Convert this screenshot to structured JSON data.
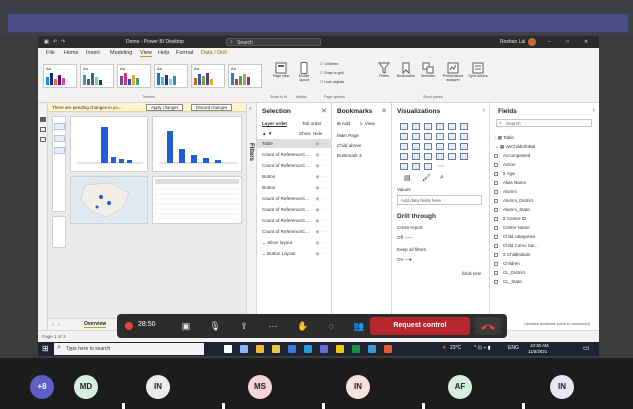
{
  "app": {
    "window_title": "Demo - Power BI Desktop",
    "search_placeholder": "Search",
    "user": "Roshan Lal",
    "user_initials": "RL",
    "contextual_tab": "Data / Drill"
  },
  "ribbon": {
    "tabs": [
      "File",
      "Home",
      "Insert",
      "Modeling",
      "View",
      "Help",
      "Format"
    ],
    "active_tab": "View",
    "groups": {
      "themes": "Themes",
      "scale": "Scale to fit",
      "mobile": "Mobile",
      "page_options": "Page options",
      "show_panes": "Show panes"
    },
    "buttons": {
      "page_view": "Page view",
      "mobile_layout": "Mobile layout",
      "gridlines": "Gridlines",
      "snap": "Snap to grid",
      "lock": "Lock objects",
      "filters": "Filters",
      "bookmarks": "Bookmarks",
      "selection": "Selection",
      "performance": "Performance analyzer",
      "sync": "Sync slicers"
    }
  },
  "warning": {
    "text": "There are pending changes in yo...",
    "apply": "Apply changes",
    "discard": "Discard changes"
  },
  "filters_label": "Filters",
  "selection_pane": {
    "title": "Selection",
    "tab_layer": "Layer order",
    "tab_order": "Tab order",
    "show": "Show",
    "hide": "Hide",
    "items": [
      "Table",
      "Count of ReferenceC...",
      "Count of ReferenceC...",
      "Button",
      "Button",
      "Count of ReferenceC...",
      "Count of ReferenceC...",
      "Count of ReferenceC...",
      "Count of ReferenceC...",
      "Slicer layout",
      "Button Layout"
    ]
  },
  "bookmarks_pane": {
    "title": "Bookmarks",
    "add": "Add",
    "view": "View",
    "items": [
      "Main Page",
      "Child above",
      "Bookmark 3"
    ]
  },
  "visualizations_pane": {
    "title": "Visualizations",
    "values_label": "Values",
    "add_fields": "Add data fields here",
    "drill_through": "Drill through",
    "cross_report": "Cross-report",
    "cross_report_state": "Off",
    "keep_filters": "Keep all filters",
    "keep_filters_state": "On",
    "drill_fields": "fields here"
  },
  "fields_pane": {
    "title": "Fields",
    "search_placeholder": "Search",
    "tables": [
      "Table",
      "vwChildInfoBal"
    ],
    "fields": [
      "Accompanied",
      "Action",
      "Age",
      "Alias Name",
      "Alumni",
      "Alumni_District",
      "Alumni_State",
      "Centre ID",
      "Centre Name",
      "Child categories",
      "Child Como Sw...",
      "ChildInitials",
      "Children",
      "CL_District",
      "CL_State"
    ],
    "update_text": "Updates available (click to download)"
  },
  "page_tabs": [
    "Overview"
  ],
  "status": {
    "page": "Page 1 of 3"
  },
  "meeting": {
    "rec_time": "28:50",
    "request_control": "Request control"
  },
  "taskbar": {
    "search": "Type here to search",
    "weather": "23°C",
    "lang": "ENG",
    "time": "10:30 AM",
    "date": "11/5/2021"
  },
  "participants": [
    {
      "label": "+8",
      "color": "#5b5fc7"
    },
    {
      "label": "MD",
      "color": "#d7efe0"
    },
    {
      "label": "IN",
      "color": "#ececec"
    },
    {
      "label": "MS",
      "color": "#f5d5d8"
    },
    {
      "label": "IN",
      "color": "#f6e2da"
    },
    {
      "label": "AF",
      "color": "#d6eedf"
    },
    {
      "label": "IN",
      "color": "#e9e6f6"
    }
  ],
  "colors": {
    "accent": "#c7a400",
    "meeting_red": "#b7262c",
    "chart_blue": "#1f5fd6"
  }
}
